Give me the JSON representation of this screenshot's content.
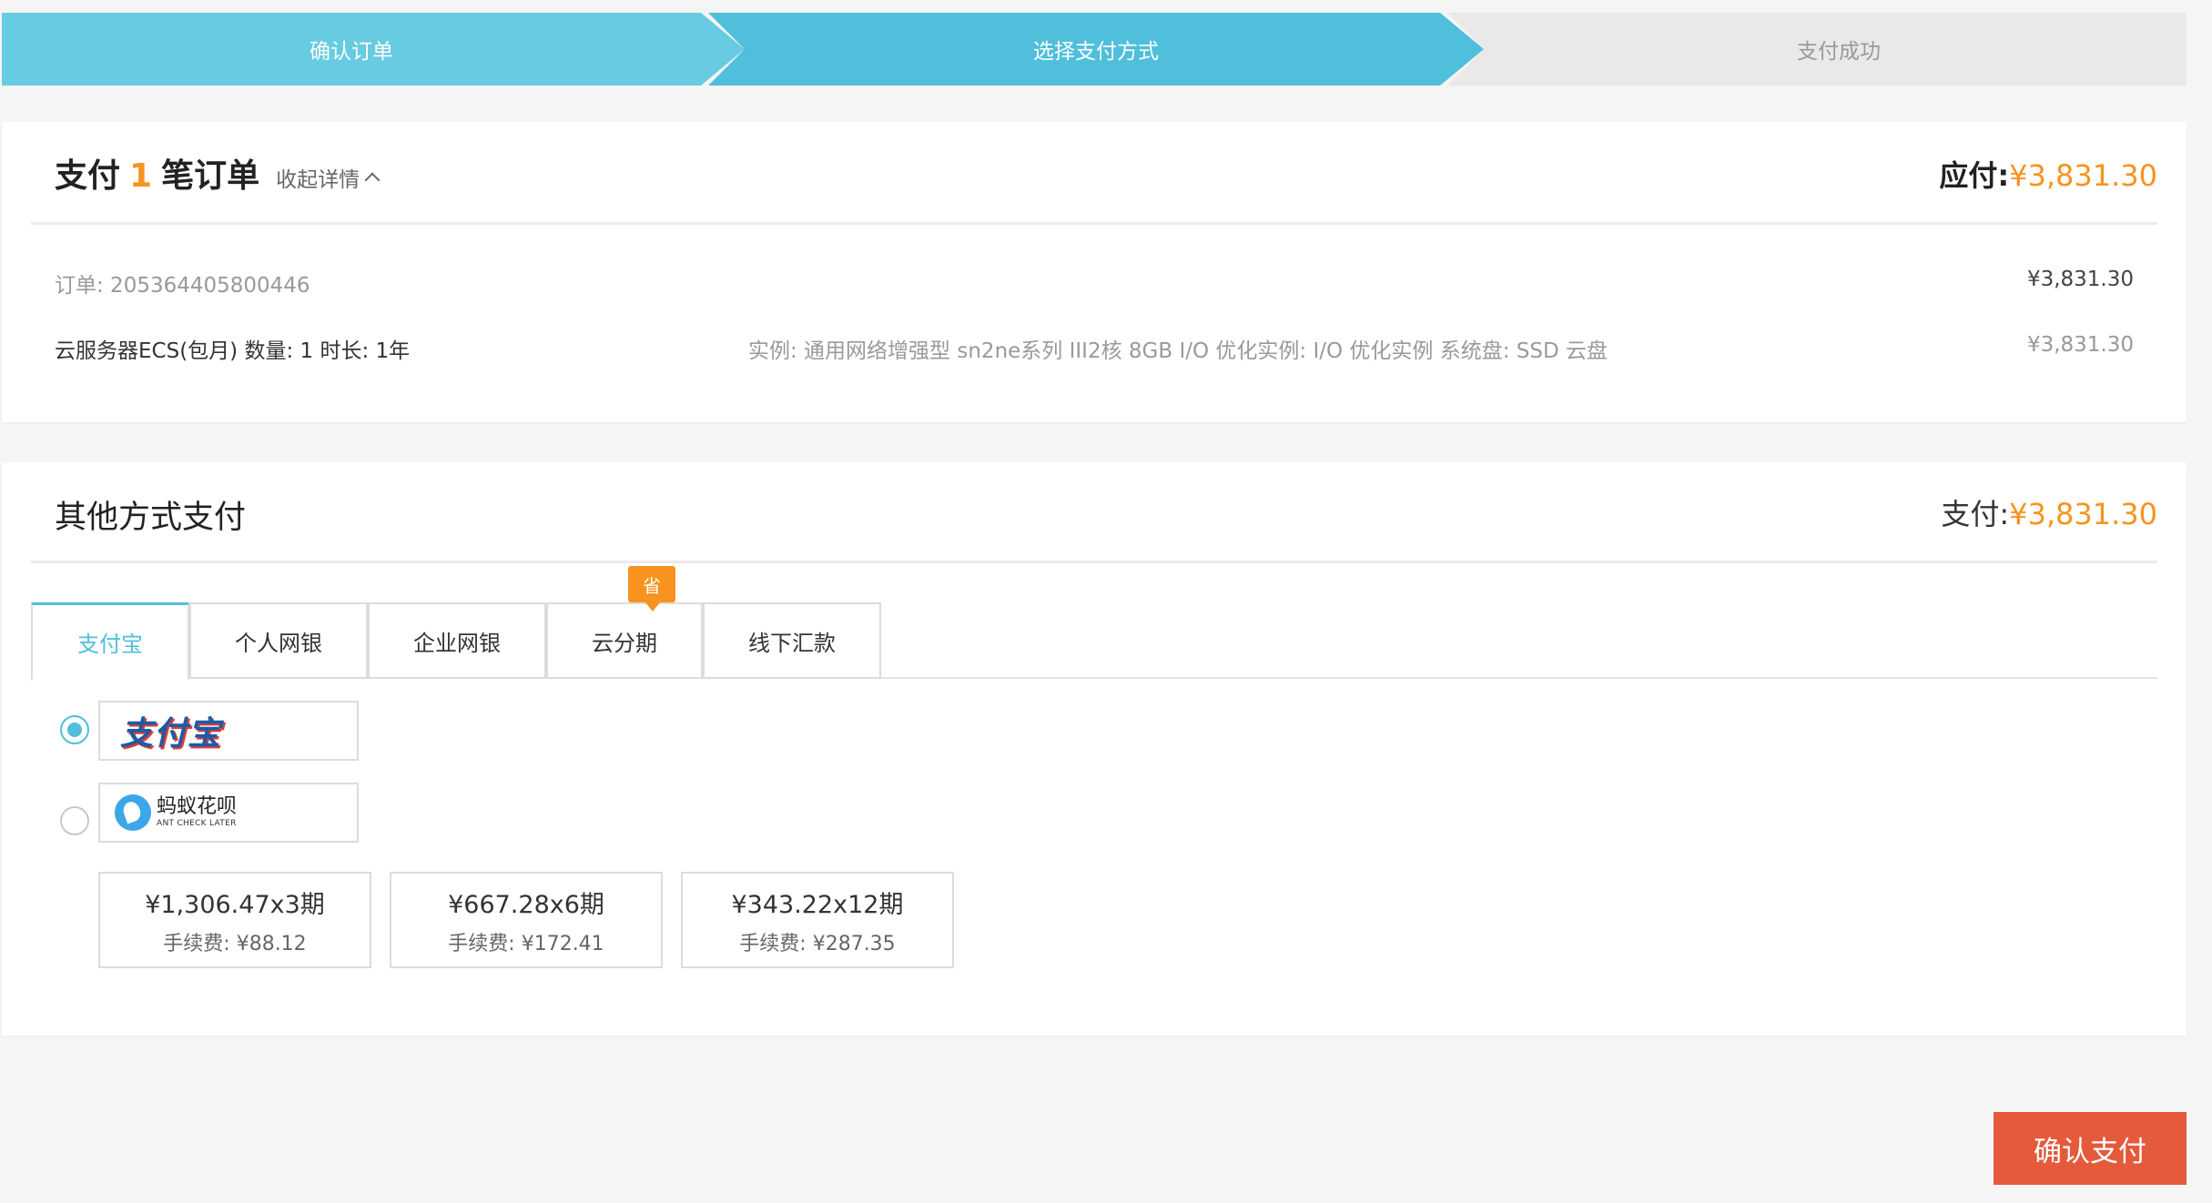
{
  "steps": [
    "确认订单",
    "选择支付方式",
    "支付成功"
  ],
  "order_summary": {
    "title_prefix": "支付",
    "count": "1",
    "title_suffix": "笔订单",
    "collapse_label": "收起详情",
    "due_label": "应付:",
    "due_amount": "¥3,831.30"
  },
  "order": {
    "number_label": "订单: 205364405800446",
    "number_amount": "¥3,831.30",
    "product": "云服务器ECS(包月) 数量: 1 时长: 1年",
    "spec": "实例: 通用网络增强型 sn2ne系列 III2核 8GB I/O 优化实例: I/O 优化实例 系统盘: SSD 云盘",
    "product_amount": "¥3,831.30"
  },
  "payment": {
    "title": "其他方式支付",
    "total_label": "支付:",
    "total_amount": "¥3,831.30",
    "tabs": [
      "支付宝",
      "个人网银",
      "企业网银",
      "云分期",
      "线下汇款"
    ],
    "active_tab": 0,
    "save_badge": "省",
    "methods": {
      "alipay_logo": "支付宝",
      "huabei_cn": "蚂蚁花呗",
      "huabei_en": "ANT CHECK LATER"
    },
    "plans": [
      {
        "main": "¥1,306.47x3期",
        "fee": "手续费: ¥88.12"
      },
      {
        "main": "¥667.28x6期",
        "fee": "手续费: ¥172.41"
      },
      {
        "main": "¥343.22x12期",
        "fee": "手续费: ¥287.35"
      }
    ]
  },
  "confirm_button": "确认支付",
  "colors": {
    "accent": "#4fbfdc",
    "step_done": "#67cbe2",
    "price": "#f7931e",
    "confirm": "#e45a3b"
  }
}
